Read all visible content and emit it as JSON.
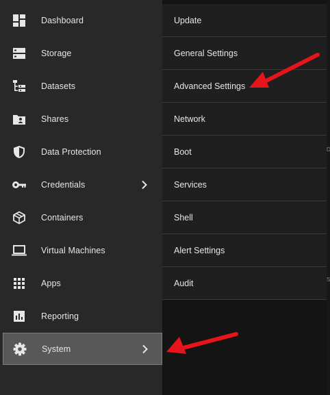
{
  "sidebar": {
    "items": [
      {
        "label": "Dashboard",
        "icon": "dashboard-icon"
      },
      {
        "label": "Storage",
        "icon": "storage-icon"
      },
      {
        "label": "Datasets",
        "icon": "datasets-icon"
      },
      {
        "label": "Shares",
        "icon": "shares-icon"
      },
      {
        "label": "Data Protection",
        "icon": "shield-icon"
      },
      {
        "label": "Credentials",
        "icon": "key-icon",
        "has_children": true
      },
      {
        "label": "Containers",
        "icon": "cube-icon"
      },
      {
        "label": "Virtual Machines",
        "icon": "laptop-icon"
      },
      {
        "label": "Apps",
        "icon": "apps-grid-icon"
      },
      {
        "label": "Reporting",
        "icon": "chart-icon"
      },
      {
        "label": "System",
        "icon": "gear-icon",
        "has_children": true,
        "active": true
      }
    ]
  },
  "submenu": {
    "items": [
      {
        "label": "Update"
      },
      {
        "label": "General Settings"
      },
      {
        "label": "Advanced Settings"
      },
      {
        "label": "Network"
      },
      {
        "label": "Boot"
      },
      {
        "label": "Services"
      },
      {
        "label": "Shell"
      },
      {
        "label": "Alert Settings"
      },
      {
        "label": "Audit"
      }
    ]
  },
  "annotations": {
    "arrow_color": "#e8141c"
  },
  "colors": {
    "sidebar_bg": "#282828",
    "submenu_bg": "#1f1f1f",
    "active_bg": "#585858",
    "text": "#e6e6e6"
  }
}
